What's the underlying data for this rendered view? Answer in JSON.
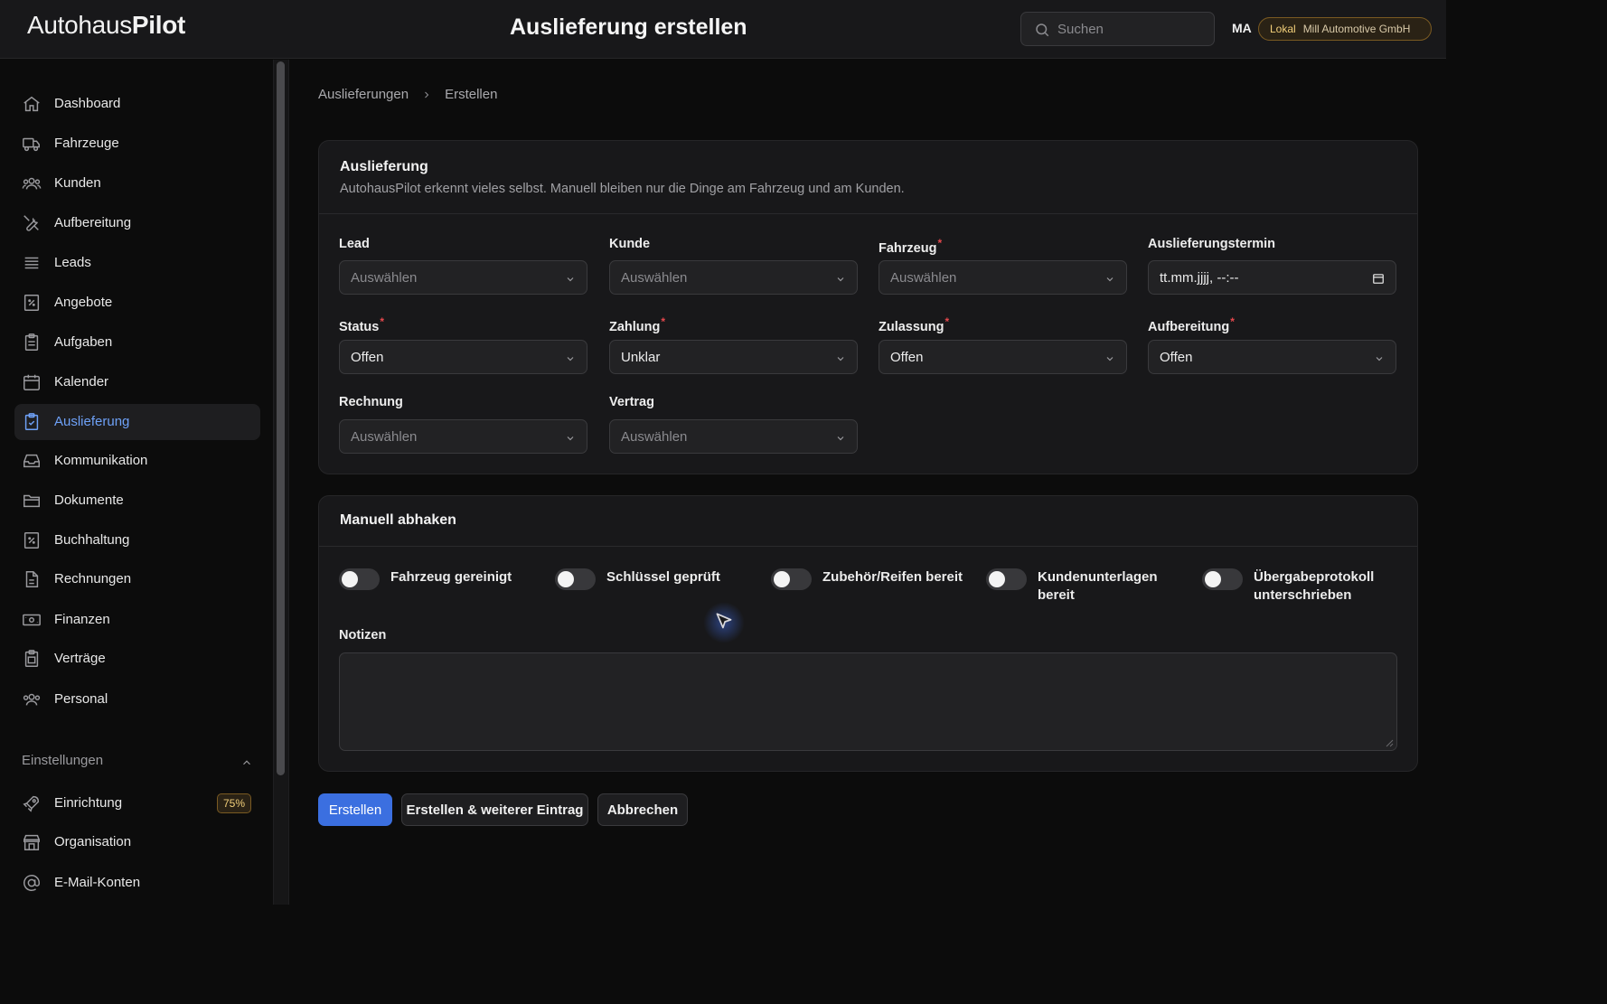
{
  "header": {
    "logo_regular": "Autohaus",
    "logo_bold": "Pilot",
    "title": "Auslieferung erstellen",
    "search_placeholder": "Suchen",
    "user_initials": "MA",
    "env_label": "Lokal",
    "org_name": "Mill Automotive GmbH"
  },
  "sidebar": {
    "items": [
      {
        "label": "Dashboard",
        "icon": "home-icon"
      },
      {
        "label": "Fahrzeuge",
        "icon": "truck-icon"
      },
      {
        "label": "Kunden",
        "icon": "users-icon"
      },
      {
        "label": "Aufbereitung",
        "icon": "wrench-screwdriver-icon"
      },
      {
        "label": "Leads",
        "icon": "queue-list-icon"
      },
      {
        "label": "Angebote",
        "icon": "receipt-percent-icon"
      },
      {
        "label": "Aufgaben",
        "icon": "clipboard-list-icon"
      },
      {
        "label": "Kalender",
        "icon": "calendar-icon"
      },
      {
        "label": "Auslieferung",
        "icon": "clipboard-check-icon",
        "active": true
      },
      {
        "label": "Kommunikation",
        "icon": "inbox-icon"
      },
      {
        "label": "Dokumente",
        "icon": "folder-icon"
      },
      {
        "label": "Buchhaltung",
        "icon": "receipt-percent-icon"
      },
      {
        "label": "Rechnungen",
        "icon": "document-icon"
      },
      {
        "label": "Finanzen",
        "icon": "banknotes-icon"
      },
      {
        "label": "Verträge",
        "icon": "clipboard-document-icon"
      },
      {
        "label": "Personal",
        "icon": "user-group-icon"
      }
    ],
    "settings_group": {
      "label": "Einstellungen",
      "items": [
        {
          "label": "Einrichtung",
          "icon": "rocket-icon",
          "badge": "75%"
        },
        {
          "label": "Organisation",
          "icon": "building-storefront-icon"
        },
        {
          "label": "E-Mail-Konten",
          "icon": "at-symbol-icon"
        }
      ]
    }
  },
  "breadcrumb": {
    "parent": "Auslieferungen",
    "current": "Erstellen"
  },
  "form": {
    "section_title": "Auslieferung",
    "section_subtitle": "AutohausPilot erkennt vieles selbst. Manuell bleiben nur die Dinge am Fahrzeug und am Kunden.",
    "fields": {
      "lead": {
        "label": "Lead",
        "value": "Auswählen"
      },
      "kunde": {
        "label": "Kunde",
        "value": "Auswählen"
      },
      "fahrzeug": {
        "label": "Fahrzeug",
        "value": "Auswählen",
        "required": true
      },
      "termin": {
        "label": "Auslieferungstermin",
        "value": "tt.mm.jjjj, --:--"
      },
      "status": {
        "label": "Status",
        "value": "Offen",
        "required": true
      },
      "zahlung": {
        "label": "Zahlung",
        "value": "Unklar",
        "required": true
      },
      "zulassung": {
        "label": "Zulassung",
        "value": "Offen",
        "required": true
      },
      "aufbereitung": {
        "label": "Aufbereitung",
        "value": "Offen",
        "required": true
      },
      "rechnung": {
        "label": "Rechnung",
        "value": "Auswählen"
      },
      "vertrag": {
        "label": "Vertrag",
        "value": "Auswählen"
      }
    }
  },
  "checklist": {
    "section_title": "Manuell abhaken",
    "toggles": [
      {
        "label": "Fahrzeug gereinigt",
        "on": false
      },
      {
        "label": "Schlüssel geprüft",
        "on": false
      },
      {
        "label": "Zubehör/Reifen bereit",
        "on": false
      },
      {
        "label": "Kundenunterlagen bereit",
        "on": false
      },
      {
        "label": "Übergabeprotokoll unterschrieben",
        "on": false
      }
    ],
    "notes_label": "Notizen",
    "notes_value": ""
  },
  "actions": {
    "create": "Erstellen",
    "create_another": "Erstellen & weiterer Eintrag",
    "cancel": "Abbrechen"
  },
  "colors": {
    "accent": "#3b6fe0",
    "active_nav_text": "#6ea1f7",
    "required_marker": "#e5484d",
    "badge_amber": "#f2cf7a"
  }
}
